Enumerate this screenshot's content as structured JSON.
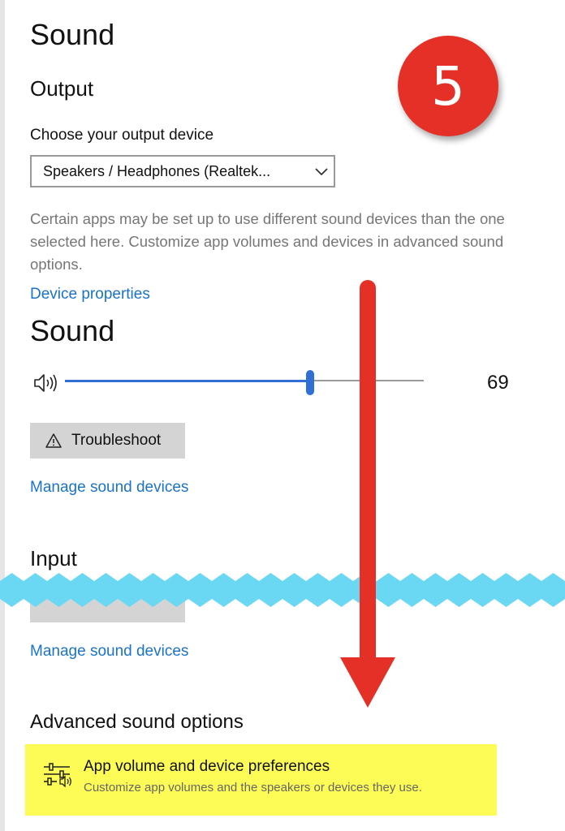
{
  "page": {
    "title": "Sound"
  },
  "output": {
    "heading": "Output",
    "device_label": "Choose your output device",
    "device_value": "Speakers / Headphones (Realtek...",
    "description": "Certain apps may be set up to use different sound devices than the one selected here. Customize app volumes and devices in advanced sound options.",
    "device_properties_link": "Device properties"
  },
  "volume": {
    "heading": "Sound",
    "value": 69,
    "value_text": "69"
  },
  "troubleshoot": {
    "label": "Troubleshoot"
  },
  "manage_link": "Manage sound devices",
  "input": {
    "heading": "Input",
    "manage_link": "Manage sound devices"
  },
  "advanced": {
    "heading": "Advanced sound options",
    "item_title": "App volume and device preferences",
    "item_subtitle": "Customize app volumes and the speakers or devices they use."
  },
  "annotation": {
    "step_number": "5",
    "badge_color": "#e53027",
    "arrow_color": "#e53027",
    "highlight_color": "#fdfc57",
    "cut_color": "#6ad8f3"
  },
  "icons": {
    "speaker": "speaker-volume-icon",
    "warning": "warning-triangle-icon",
    "chevron": "chevron-down-icon",
    "equalizer": "equalizer-sliders-icon"
  }
}
